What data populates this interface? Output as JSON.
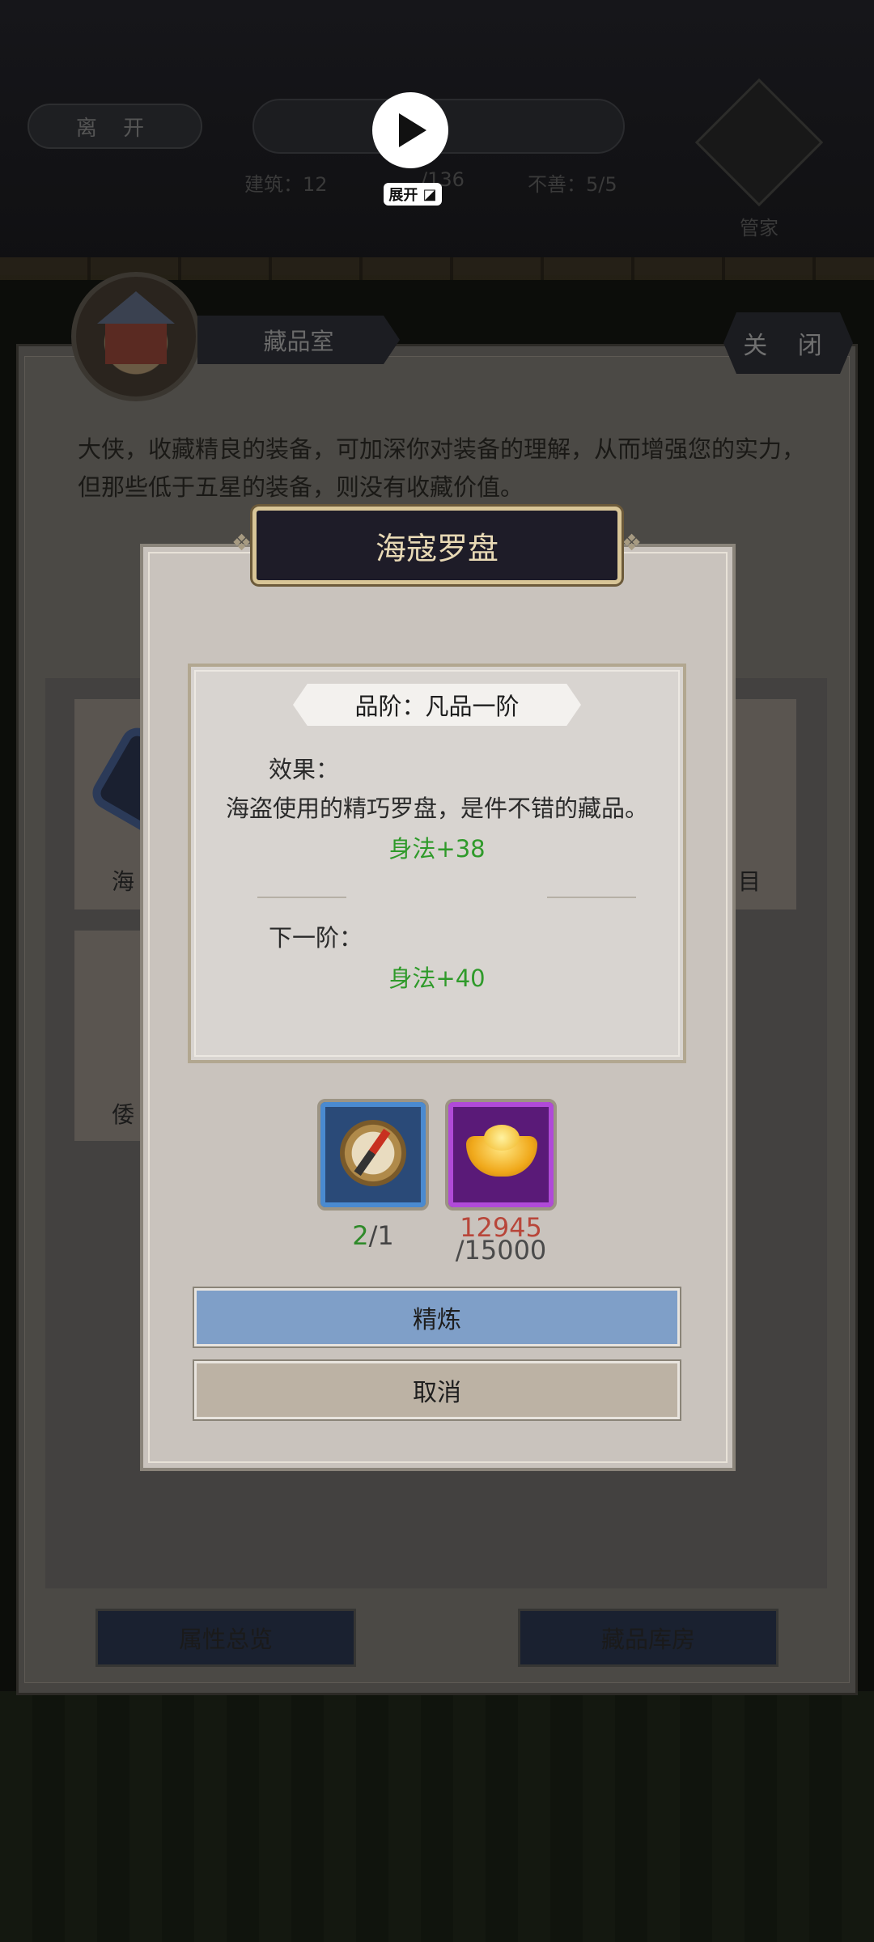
{
  "top_bar": {
    "leave_label": "离 开",
    "stats": [
      "建筑：12",
      "/136",
      "不善：5/5"
    ],
    "manager_label": "管家",
    "expand_label": "展开"
  },
  "panel": {
    "room_name": "藏品室",
    "close_label": "关 闭",
    "description": "大侠，收藏精良的装备，可加深你对装备的理解，从而增强您的实力，但那些低于五星的装备，则没有收藏价值。",
    "bg_cards": [
      "海",
      "目",
      "倭"
    ],
    "attr_overview_label": "属性总览",
    "storage_label": "藏品库房"
  },
  "dialog": {
    "title": "海寇罗盘",
    "tier": "品阶：凡品一阶",
    "effect_label": "效果：",
    "effect_desc": "海盗使用的精巧罗盘，是件不错的藏品。",
    "current_bonus": "身法+38",
    "next_label": "下一阶：",
    "next_bonus": "身法+40",
    "materials": [
      {
        "icon": "compass-icon",
        "have": "2",
        "need": "/1"
      },
      {
        "icon": "gold-ingot-icon",
        "have": "12945",
        "need": "/15000"
      }
    ],
    "refine_label": "精炼",
    "cancel_label": "取消"
  },
  "colors": {
    "dialog_bg": "#c9c3bd",
    "title_bg": "#1e1c28",
    "bonus_green": "#2f9a2a",
    "shortage_red": "#b8463a",
    "refine_blue": "#7f9fc8"
  }
}
